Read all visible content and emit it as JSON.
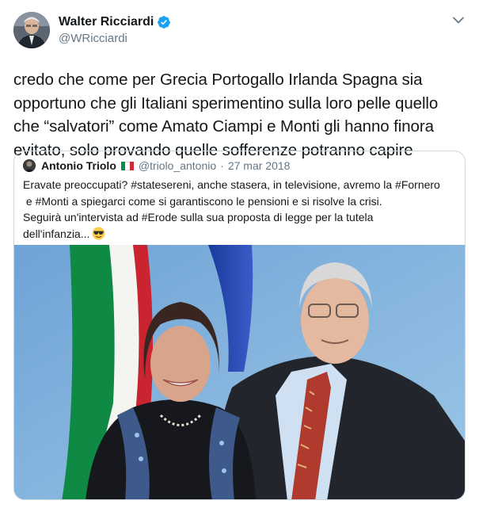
{
  "tweet": {
    "author": {
      "display_name": "Walter Ricciardi",
      "handle": "@WRicciardi",
      "verified": true,
      "avatar_icon": "user-avatar-photo"
    },
    "text_lines": [
      "credo che come per Grecia Portogallo Irlanda Spagna sia",
      "opportuno che gli Italiani sperimentino sulla loro pelle quello",
      "che “salvatori” come Amato Ciampi e Monti gli hanno finora",
      "evitato, solo provando quelle sofferenze potranno capire"
    ],
    "menu_icon": "chevron-down-icon"
  },
  "quoted_tweet": {
    "author": {
      "display_name": "Antonio Triolo",
      "flag": "🇮🇹",
      "handle": "@triolo_antonio",
      "date": "27 mar 2018",
      "separator": "·"
    },
    "text_lines": [
      "Eravate preoccupati? #statesereni, anche stasera, in televisione, avremo la #Fornero",
      " e #Monti a spiegarci come si garantiscono le pensioni e si risolve la crisi.",
      "Seguirà un'intervista ad #Erode sulla sua proposta di legge per la tutela",
      "dell'infanzia..."
    ],
    "emoji": "😎",
    "media": {
      "type": "photo",
      "description_icon": "press-photo"
    }
  },
  "colors": {
    "text_primary": "#14171a",
    "text_secondary": "#657786",
    "border": "#ccd6dd",
    "verified_blue": "#1da1f2",
    "flag_green": "#009246",
    "flag_white": "#ffffff",
    "flag_red": "#ce2b37"
  }
}
